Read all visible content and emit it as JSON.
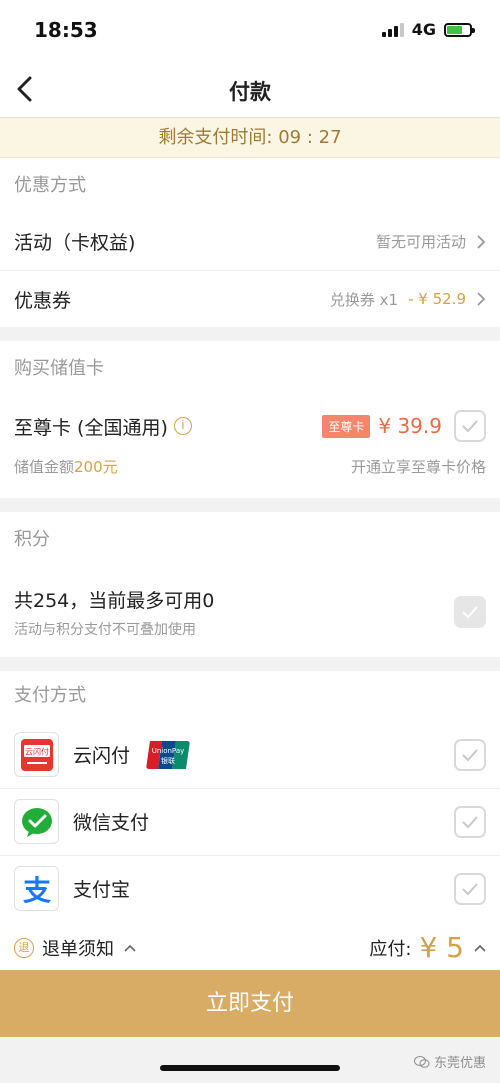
{
  "status_bar": {
    "time": "18:53",
    "network": "4G"
  },
  "header": {
    "title": "付款"
  },
  "countdown": {
    "text": "剩余支付时间: 09 : 27"
  },
  "discount_section": {
    "title": "优惠方式",
    "activity": {
      "label": "活动（卡权益)",
      "value": "暂无可用活动"
    },
    "coupon": {
      "label": "优惠券",
      "value": "兑换券 x1",
      "discount": "- ¥ 52.9"
    }
  },
  "card_section": {
    "title": "购买储值卡",
    "card_name": "至尊卡 (全国通用)",
    "badge": "至尊卡",
    "price": "¥ 39.9",
    "stored_label": "储值金额",
    "stored_amount": "200元",
    "perk": "开通立享至尊卡价格"
  },
  "points_section": {
    "title": "积分",
    "summary": "共254，当前最多可用0",
    "note": "活动与积分支付不可叠加使用"
  },
  "payment_section": {
    "title": "支付方式",
    "methods": [
      {
        "label": "云闪付",
        "icon": "yunshanfu-icon"
      },
      {
        "label": "微信支付",
        "icon": "wechat-pay-icon"
      },
      {
        "label": "支付宝",
        "icon": "alipay-icon"
      }
    ]
  },
  "summary": {
    "refund_icon": "退",
    "refund_label": "退单须知",
    "due_label": "应付:",
    "due_amount": "¥ 5"
  },
  "pay_button": {
    "label": "立即支付"
  },
  "watermark": {
    "text": "东莞优惠"
  },
  "colors": {
    "gold": "#d4a14b",
    "button": "#d9ac66",
    "price": "#e76b47",
    "countdown_bg": "#fbf6e4"
  }
}
